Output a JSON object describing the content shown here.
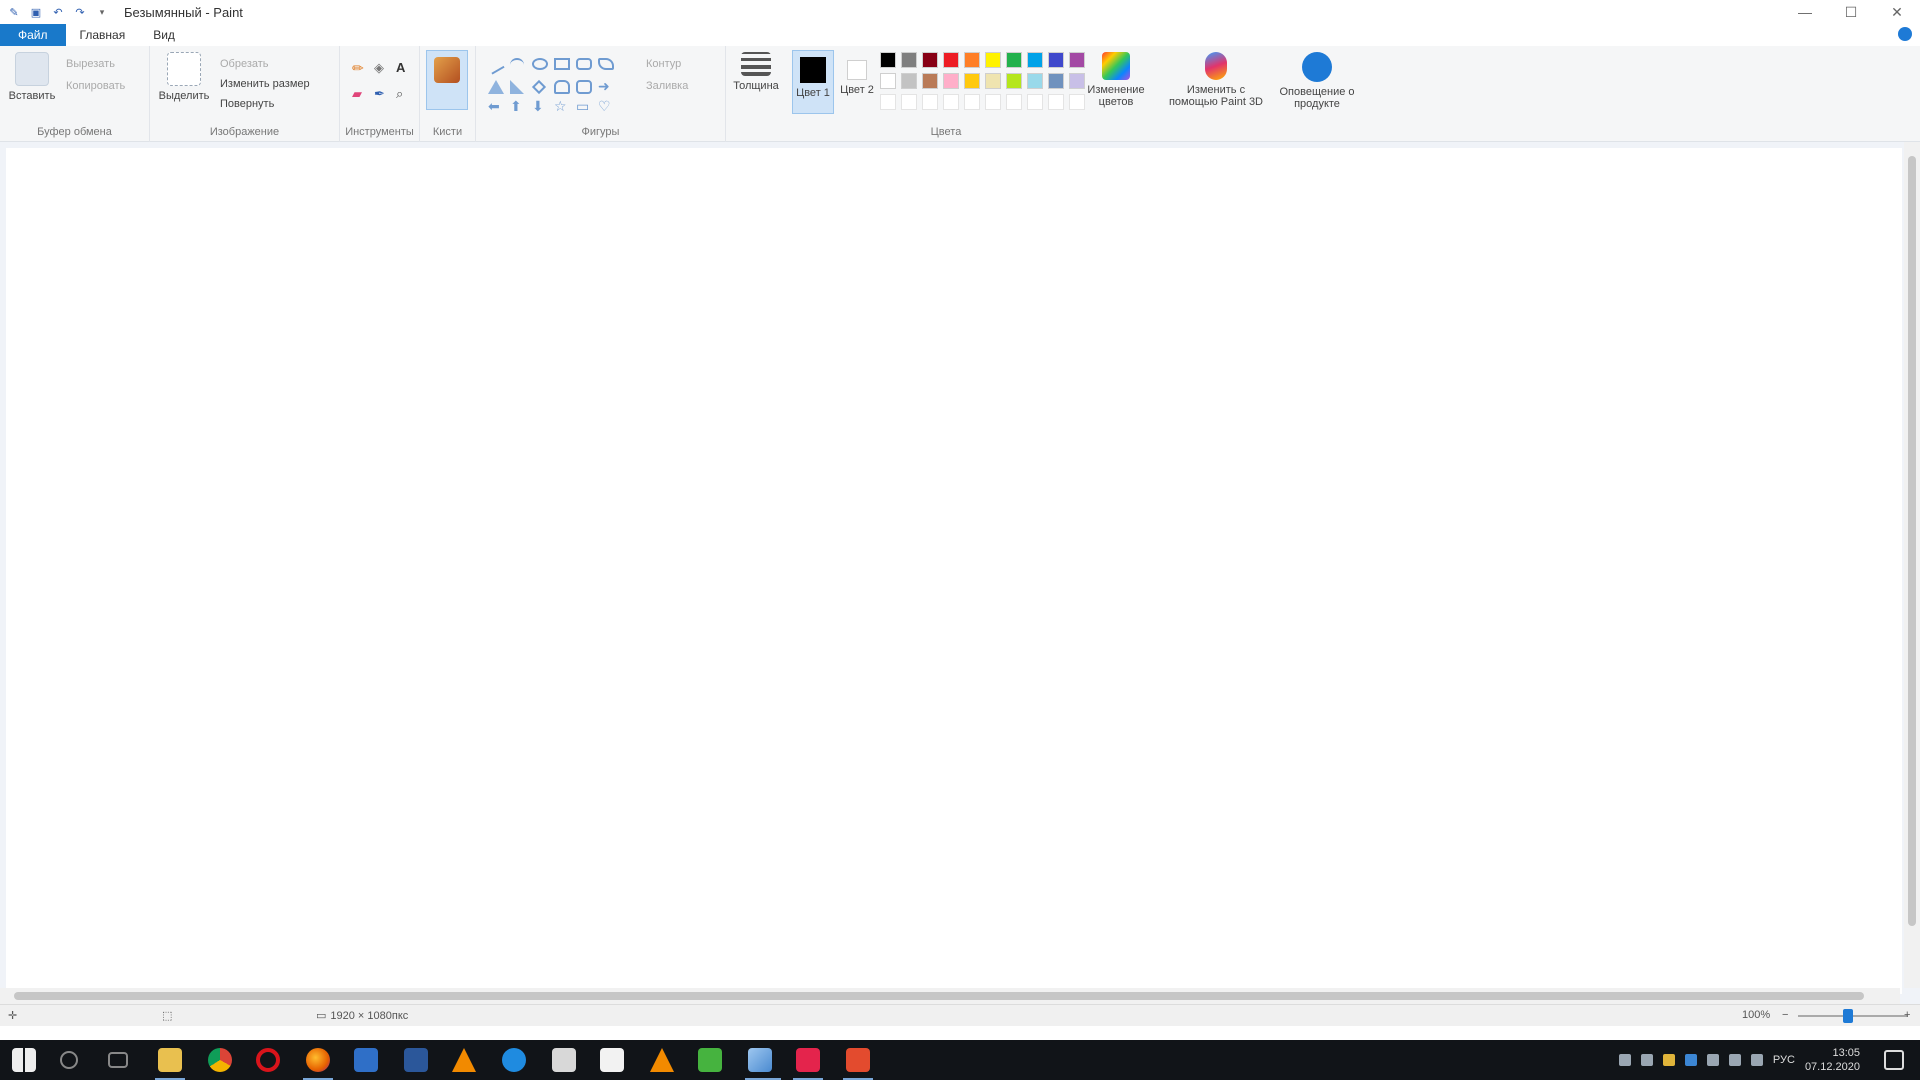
{
  "window": {
    "title": "Безымянный - Paint",
    "controls": {
      "minimize": "—",
      "maximize": "☐",
      "close": "✕"
    }
  },
  "tabs": [
    {
      "label": "Файл",
      "active": true
    },
    {
      "label": "Главная",
      "active": false
    },
    {
      "label": "Вид",
      "active": false
    }
  ],
  "ribbon": {
    "clipboard": {
      "label": "Буфер обмена",
      "paste": "Вставить",
      "cut": "Вырезать",
      "copy": "Копировать"
    },
    "image": {
      "label": "Изображение",
      "select": "Выделить",
      "crop": "Обрезать",
      "resize": "Изменить размер",
      "rotate": "Повернуть"
    },
    "tools": {
      "label": "Инструменты"
    },
    "brushes": {
      "label": "Кисти"
    },
    "shapes": {
      "label": "Фигуры",
      "outline": "Контур",
      "fill": "Заливка"
    },
    "size": {
      "label": "Толщина"
    },
    "colors": {
      "label": "Цвета",
      "color1": "Цвет 1",
      "color2": "Цвет 2",
      "edit": "Изменение цветов",
      "paint3d": "Изменить с помощью Paint 3D",
      "product_alert": "Оповещение о продукте",
      "primary": "#000000",
      "secondary": "#ffffff",
      "palette_row1": [
        "#000000",
        "#7f7f7f",
        "#880015",
        "#ed1c24",
        "#ff7f27",
        "#fff200",
        "#22b14c",
        "#00a2e8",
        "#3f48cc",
        "#a349a4"
      ],
      "palette_row2": [
        "#ffffff",
        "#c3c3c3",
        "#b97a57",
        "#ffaec9",
        "#ffc90e",
        "#efe4b0",
        "#b5e61d",
        "#99d9ea",
        "#7092be",
        "#c8bfe7"
      ]
    }
  },
  "statusbar": {
    "dimensions": "1920 × 1080пкс",
    "zoom": "100%"
  },
  "taskbar": {
    "time": "13:05",
    "date": "07.12.2020",
    "lang": "РУС",
    "icons": [
      "start-icon",
      "search-icon",
      "task-view-icon",
      "file-explorer-icon",
      "chrome-icon",
      "opera-icon",
      "firefox-icon",
      "mail-icon",
      "word-icon",
      "vlc-icon",
      "edge-icon",
      "camera-icon",
      "notepad-icon",
      "vlc-icon-2",
      "green-app-icon",
      "paint-icon",
      "media-icon",
      "office-icon"
    ]
  }
}
